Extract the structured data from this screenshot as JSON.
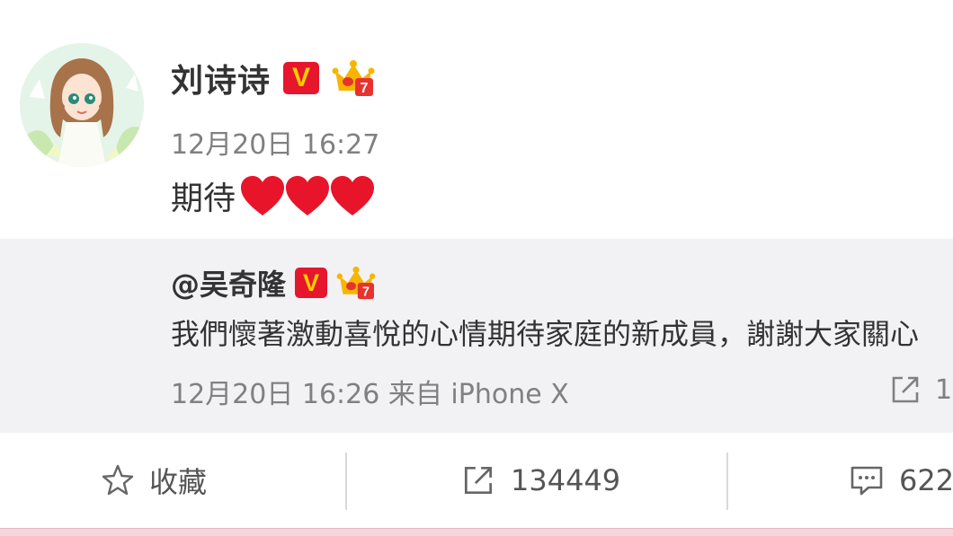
{
  "post": {
    "author": "刘诗诗",
    "time": "12月20日 16:27",
    "text": "期待",
    "hearts": 3
  },
  "repost": {
    "author": "@吴奇隆",
    "text": "我們懷著激動喜悅的心情期待家庭的新成員，謝謝大家關心",
    "meta": "12月20日 16:26 来自 iPhone X",
    "share_count": "1"
  },
  "actions": {
    "favorite_label": "收藏",
    "repost_count": "134449",
    "comment_count": "622"
  },
  "colors": {
    "verified_badge": "#e6162d",
    "verified_letter": "#ffcc00",
    "heart": "#e8152a",
    "repost_bg": "#f2f2f5",
    "muted_text": "#808080"
  },
  "icons": [
    "verified-v-icon",
    "vip-crown-icon",
    "heart-icon",
    "star-icon",
    "share-icon",
    "comment-icon"
  ]
}
